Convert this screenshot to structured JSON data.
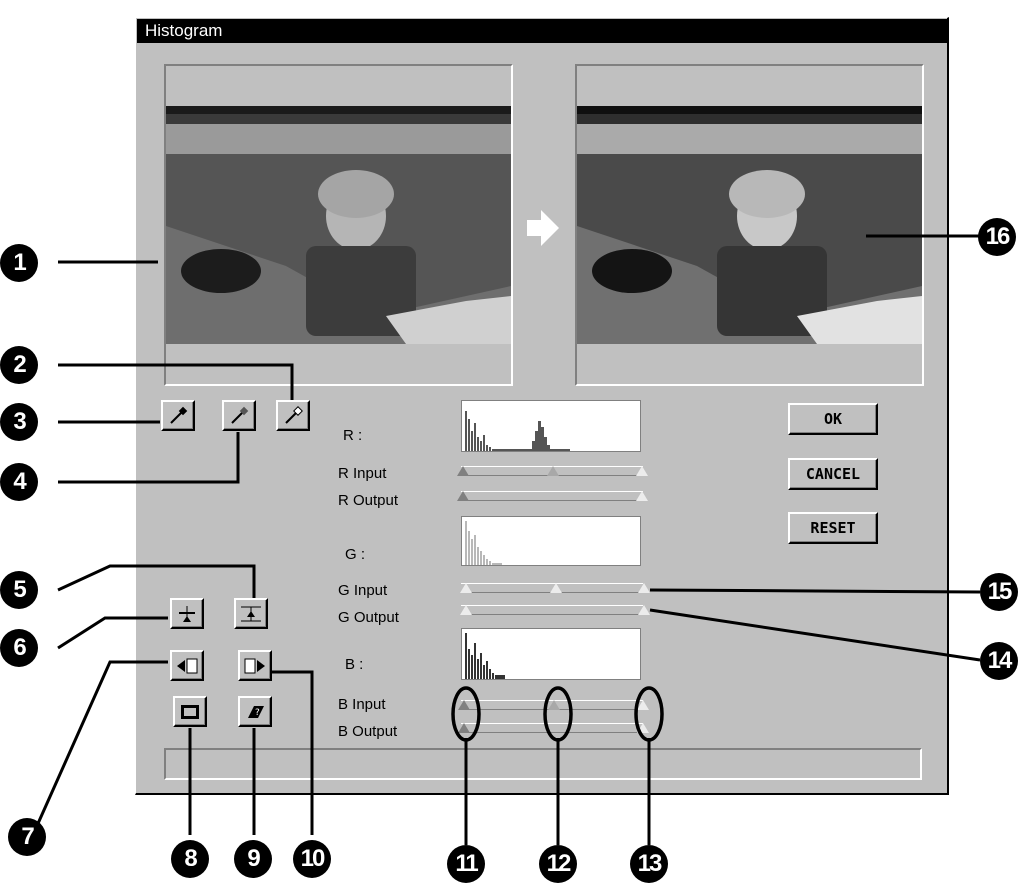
{
  "window": {
    "title": "Histogram"
  },
  "buttons": {
    "ok": "OK",
    "cancel": "CANCEL",
    "reset": "RESET"
  },
  "channels": [
    {
      "name": "R :",
      "input_label": "R Input",
      "output_label": "R Output"
    },
    {
      "name": "G :",
      "input_label": "G Input",
      "output_label": "G Output"
    },
    {
      "name": "B :",
      "input_label": "B Input",
      "output_label": "B Output"
    }
  ],
  "callouts": [
    "1",
    "2",
    "3",
    "4",
    "5",
    "6",
    "7",
    "8",
    "9",
    "10",
    "11",
    "12",
    "13",
    "14",
    "15",
    "16"
  ],
  "icons": {
    "eyedroppers": [
      "eyedropper-black-icon",
      "eyedropper-gray-icon",
      "eyedropper-white-icon"
    ],
    "tools": [
      "auto-level-icon",
      "auto-range-icon",
      "load-curve-icon",
      "save-curve-icon",
      "preview-window-icon",
      "help-book-icon"
    ],
    "arrow": "arrow-right-icon"
  }
}
